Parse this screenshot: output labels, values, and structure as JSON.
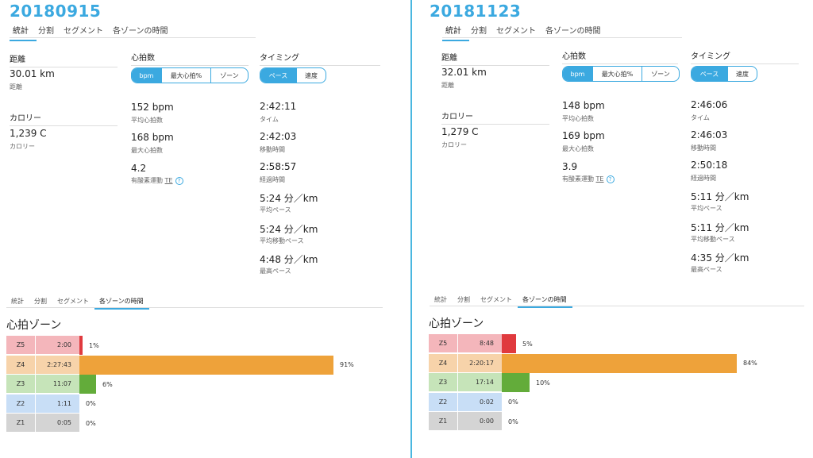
{
  "colors": {
    "accent": "#3ba9e0",
    "z5_bg": "#f4b6bb",
    "z5_bar": "#e03a3e",
    "z4_bg": "#f7d3aa",
    "z4_bar": "#eea23a",
    "z3_bg": "#c6e4b9",
    "z3_bar": "#63ac3a",
    "z2_bg": "#c8def6",
    "z2_bar": "#5aa0e0",
    "z1_bg": "#d4d4d4",
    "z1_bar": "#999999"
  },
  "panels": [
    {
      "date": "20180915",
      "tabs": [
        "統計",
        "分割",
        "セグメント",
        "各ゾーンの時間"
      ],
      "distance": {
        "heading": "距離",
        "value": "30.01 km",
        "label": "距離"
      },
      "calories": {
        "heading": "カロリー",
        "value": "1,239 C",
        "label": "カロリー"
      },
      "heart_rate": {
        "heading": "心拍数",
        "toggle": [
          "bpm",
          "最大心拍%",
          "ゾーン"
        ],
        "avg": {
          "value": "152 bpm",
          "label": "平均心拍数"
        },
        "max": {
          "value": "168 bpm",
          "label": "最大心拍数"
        },
        "te": {
          "value": "4.2",
          "label_prefix": "有酸素運動 ",
          "label_te": "TE",
          "help": "?"
        }
      },
      "timing": {
        "heading": "タイミング",
        "toggle": [
          "ペース",
          "速度"
        ],
        "items": [
          {
            "value": "2:42:11",
            "label": "タイム"
          },
          {
            "value": "2:42:03",
            "label": "移動時間"
          },
          {
            "value": "2:58:57",
            "label": "経過時間"
          },
          {
            "value": "5:24 分／km",
            "label": "平均ペース"
          },
          {
            "value": "5:24 分／km",
            "label": "平均移動ペース"
          },
          {
            "value": "4:48 分／km",
            "label": "最高ペース"
          }
        ]
      },
      "zone_tabs": [
        "統計",
        "分割",
        "セグメント",
        "各ゾーンの時間"
      ],
      "zone_title": "心拍ゾーン",
      "zones": [
        {
          "name": "Z5",
          "time": "2:00",
          "pct": "1%",
          "fraction": 0.01
        },
        {
          "name": "Z4",
          "time": "2:27:43",
          "pct": "91%",
          "fraction": 0.91
        },
        {
          "name": "Z3",
          "time": "11:07",
          "pct": "6%",
          "fraction": 0.06
        },
        {
          "name": "Z2",
          "time": "1:11",
          "pct": "0%",
          "fraction": 0.0
        },
        {
          "name": "Z1",
          "time": "0:05",
          "pct": "0%",
          "fraction": 0.0
        }
      ]
    },
    {
      "date": "20181123",
      "tabs": [
        "統計",
        "分割",
        "セグメント",
        "各ゾーンの時間"
      ],
      "distance": {
        "heading": "距離",
        "value": "32.01 km",
        "label": "距離"
      },
      "calories": {
        "heading": "カロリー",
        "value": "1,279 C",
        "label": "カロリー"
      },
      "heart_rate": {
        "heading": "心拍数",
        "toggle": [
          "bpm",
          "最大心拍%",
          "ゾーン"
        ],
        "avg": {
          "value": "148 bpm",
          "label": "平均心拍数"
        },
        "max": {
          "value": "169 bpm",
          "label": "最大心拍数"
        },
        "te": {
          "value": "3.9",
          "label_prefix": "有酸素運動 ",
          "label_te": "TE",
          "help": "?"
        }
      },
      "timing": {
        "heading": "タイミング",
        "toggle": [
          "ペース",
          "速度"
        ],
        "items": [
          {
            "value": "2:46:06",
            "label": "タイム"
          },
          {
            "value": "2:46:03",
            "label": "移動時間"
          },
          {
            "value": "2:50:18",
            "label": "経過時間"
          },
          {
            "value": "5:11 分／km",
            "label": "平均ペース"
          },
          {
            "value": "5:11 分／km",
            "label": "平均移動ペース"
          },
          {
            "value": "4:35 分／km",
            "label": "最高ペース"
          }
        ]
      },
      "zone_tabs": [
        "統計",
        "分割",
        "セグメント",
        "各ゾーンの時間"
      ],
      "zone_title": "心拍ゾーン",
      "zones": [
        {
          "name": "Z5",
          "time": "8:48",
          "pct": "5%",
          "fraction": 0.05
        },
        {
          "name": "Z4",
          "time": "2:20:17",
          "pct": "84%",
          "fraction": 0.84
        },
        {
          "name": "Z3",
          "time": "17:14",
          "pct": "10%",
          "fraction": 0.1
        },
        {
          "name": "Z2",
          "time": "0:02",
          "pct": "0%",
          "fraction": 0.0
        },
        {
          "name": "Z1",
          "time": "0:00",
          "pct": "0%",
          "fraction": 0.0
        }
      ]
    }
  ]
}
